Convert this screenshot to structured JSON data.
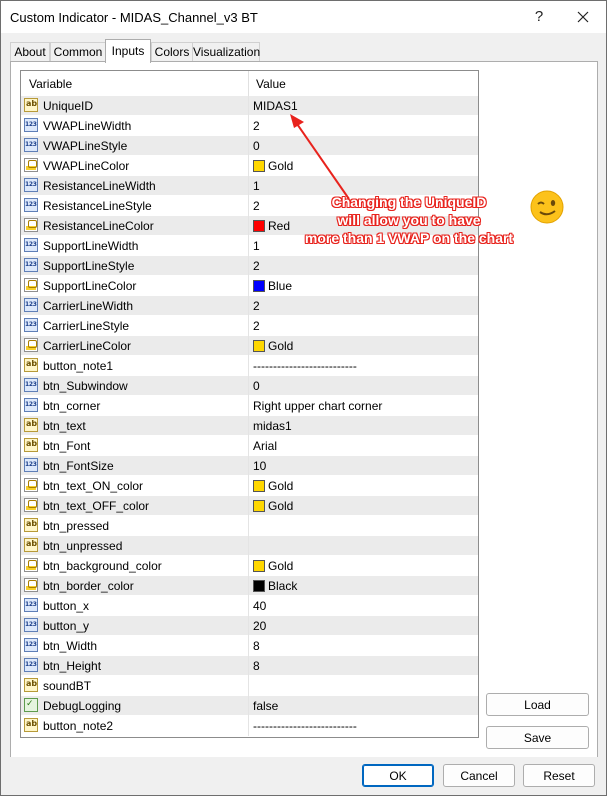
{
  "window": {
    "title": "Custom Indicator - MIDAS_Channel_v3 BT",
    "help_label": "?"
  },
  "tabs": [
    {
      "label": "About",
      "active": false
    },
    {
      "label": "Common",
      "active": false
    },
    {
      "label": "Inputs",
      "active": true
    },
    {
      "label": "Colors",
      "active": false
    },
    {
      "label": "Visualization",
      "active": false
    }
  ],
  "grid": {
    "headers": {
      "variable": "Variable",
      "value": "Value"
    },
    "rows": [
      {
        "icon": "ab",
        "name": "UniqueID",
        "value": "MIDAS1"
      },
      {
        "icon": "123",
        "name": "VWAPLineWidth",
        "value": "2"
      },
      {
        "icon": "123",
        "name": "VWAPLineStyle",
        "value": "0"
      },
      {
        "icon": "color",
        "name": "VWAPLineColor",
        "value": "Gold",
        "swatch": "#ffd700"
      },
      {
        "icon": "123",
        "name": "ResistanceLineWidth",
        "value": "1"
      },
      {
        "icon": "123",
        "name": "ResistanceLineStyle",
        "value": "2"
      },
      {
        "icon": "color",
        "name": "ResistanceLineColor",
        "value": "Red",
        "swatch": "#ff0000"
      },
      {
        "icon": "123",
        "name": "SupportLineWidth",
        "value": "1"
      },
      {
        "icon": "123",
        "name": "SupportLineStyle",
        "value": "2"
      },
      {
        "icon": "color",
        "name": "SupportLineColor",
        "value": "Blue",
        "swatch": "#0000ff"
      },
      {
        "icon": "123",
        "name": "CarrierLineWidth",
        "value": "2"
      },
      {
        "icon": "123",
        "name": "CarrierLineStyle",
        "value": "2"
      },
      {
        "icon": "color",
        "name": "CarrierLineColor",
        "value": "Gold",
        "swatch": "#ffd700"
      },
      {
        "icon": "ab",
        "name": "button_note1",
        "value": "--------------------------"
      },
      {
        "icon": "123",
        "name": "btn_Subwindow",
        "value": "0"
      },
      {
        "icon": "123",
        "name": "btn_corner",
        "value": "Right upper chart corner"
      },
      {
        "icon": "ab",
        "name": "btn_text",
        "value": "midas1"
      },
      {
        "icon": "ab",
        "name": "btn_Font",
        "value": "Arial"
      },
      {
        "icon": "123",
        "name": "btn_FontSize",
        "value": "10"
      },
      {
        "icon": "color",
        "name": "btn_text_ON_color",
        "value": "Gold",
        "swatch": "#ffd700"
      },
      {
        "icon": "color",
        "name": "btn_text_OFF_color",
        "value": "Gold",
        "swatch": "#ffd700"
      },
      {
        "icon": "ab",
        "name": "btn_pressed",
        "value": ""
      },
      {
        "icon": "ab",
        "name": "btn_unpressed",
        "value": ""
      },
      {
        "icon": "color",
        "name": "btn_background_color",
        "value": "Gold",
        "swatch": "#ffd700"
      },
      {
        "icon": "color",
        "name": "btn_border_color",
        "value": "Black",
        "swatch": "#000000"
      },
      {
        "icon": "123",
        "name": "button_x",
        "value": "40"
      },
      {
        "icon": "123",
        "name": "button_y",
        "value": "20"
      },
      {
        "icon": "123",
        "name": "btn_Width",
        "value": "8"
      },
      {
        "icon": "123",
        "name": "btn_Height",
        "value": "8"
      },
      {
        "icon": "ab",
        "name": "soundBT",
        "value": ""
      },
      {
        "icon": "bool",
        "name": "DebugLogging",
        "value": "false"
      },
      {
        "icon": "ab",
        "name": "button_note2",
        "value": "--------------------------"
      }
    ]
  },
  "annotation": {
    "lines": [
      "Changing the UniqueID",
      "will allow you to have",
      "more than 1 VWAP on the chart"
    ],
    "color": "#e8231d"
  },
  "side_buttons": {
    "load": "Load",
    "save": "Save"
  },
  "footer_buttons": {
    "ok": "OK",
    "cancel": "Cancel",
    "reset": "Reset"
  },
  "colors": {
    "accent": "#0067c0",
    "row_alt": "#ebebeb"
  }
}
